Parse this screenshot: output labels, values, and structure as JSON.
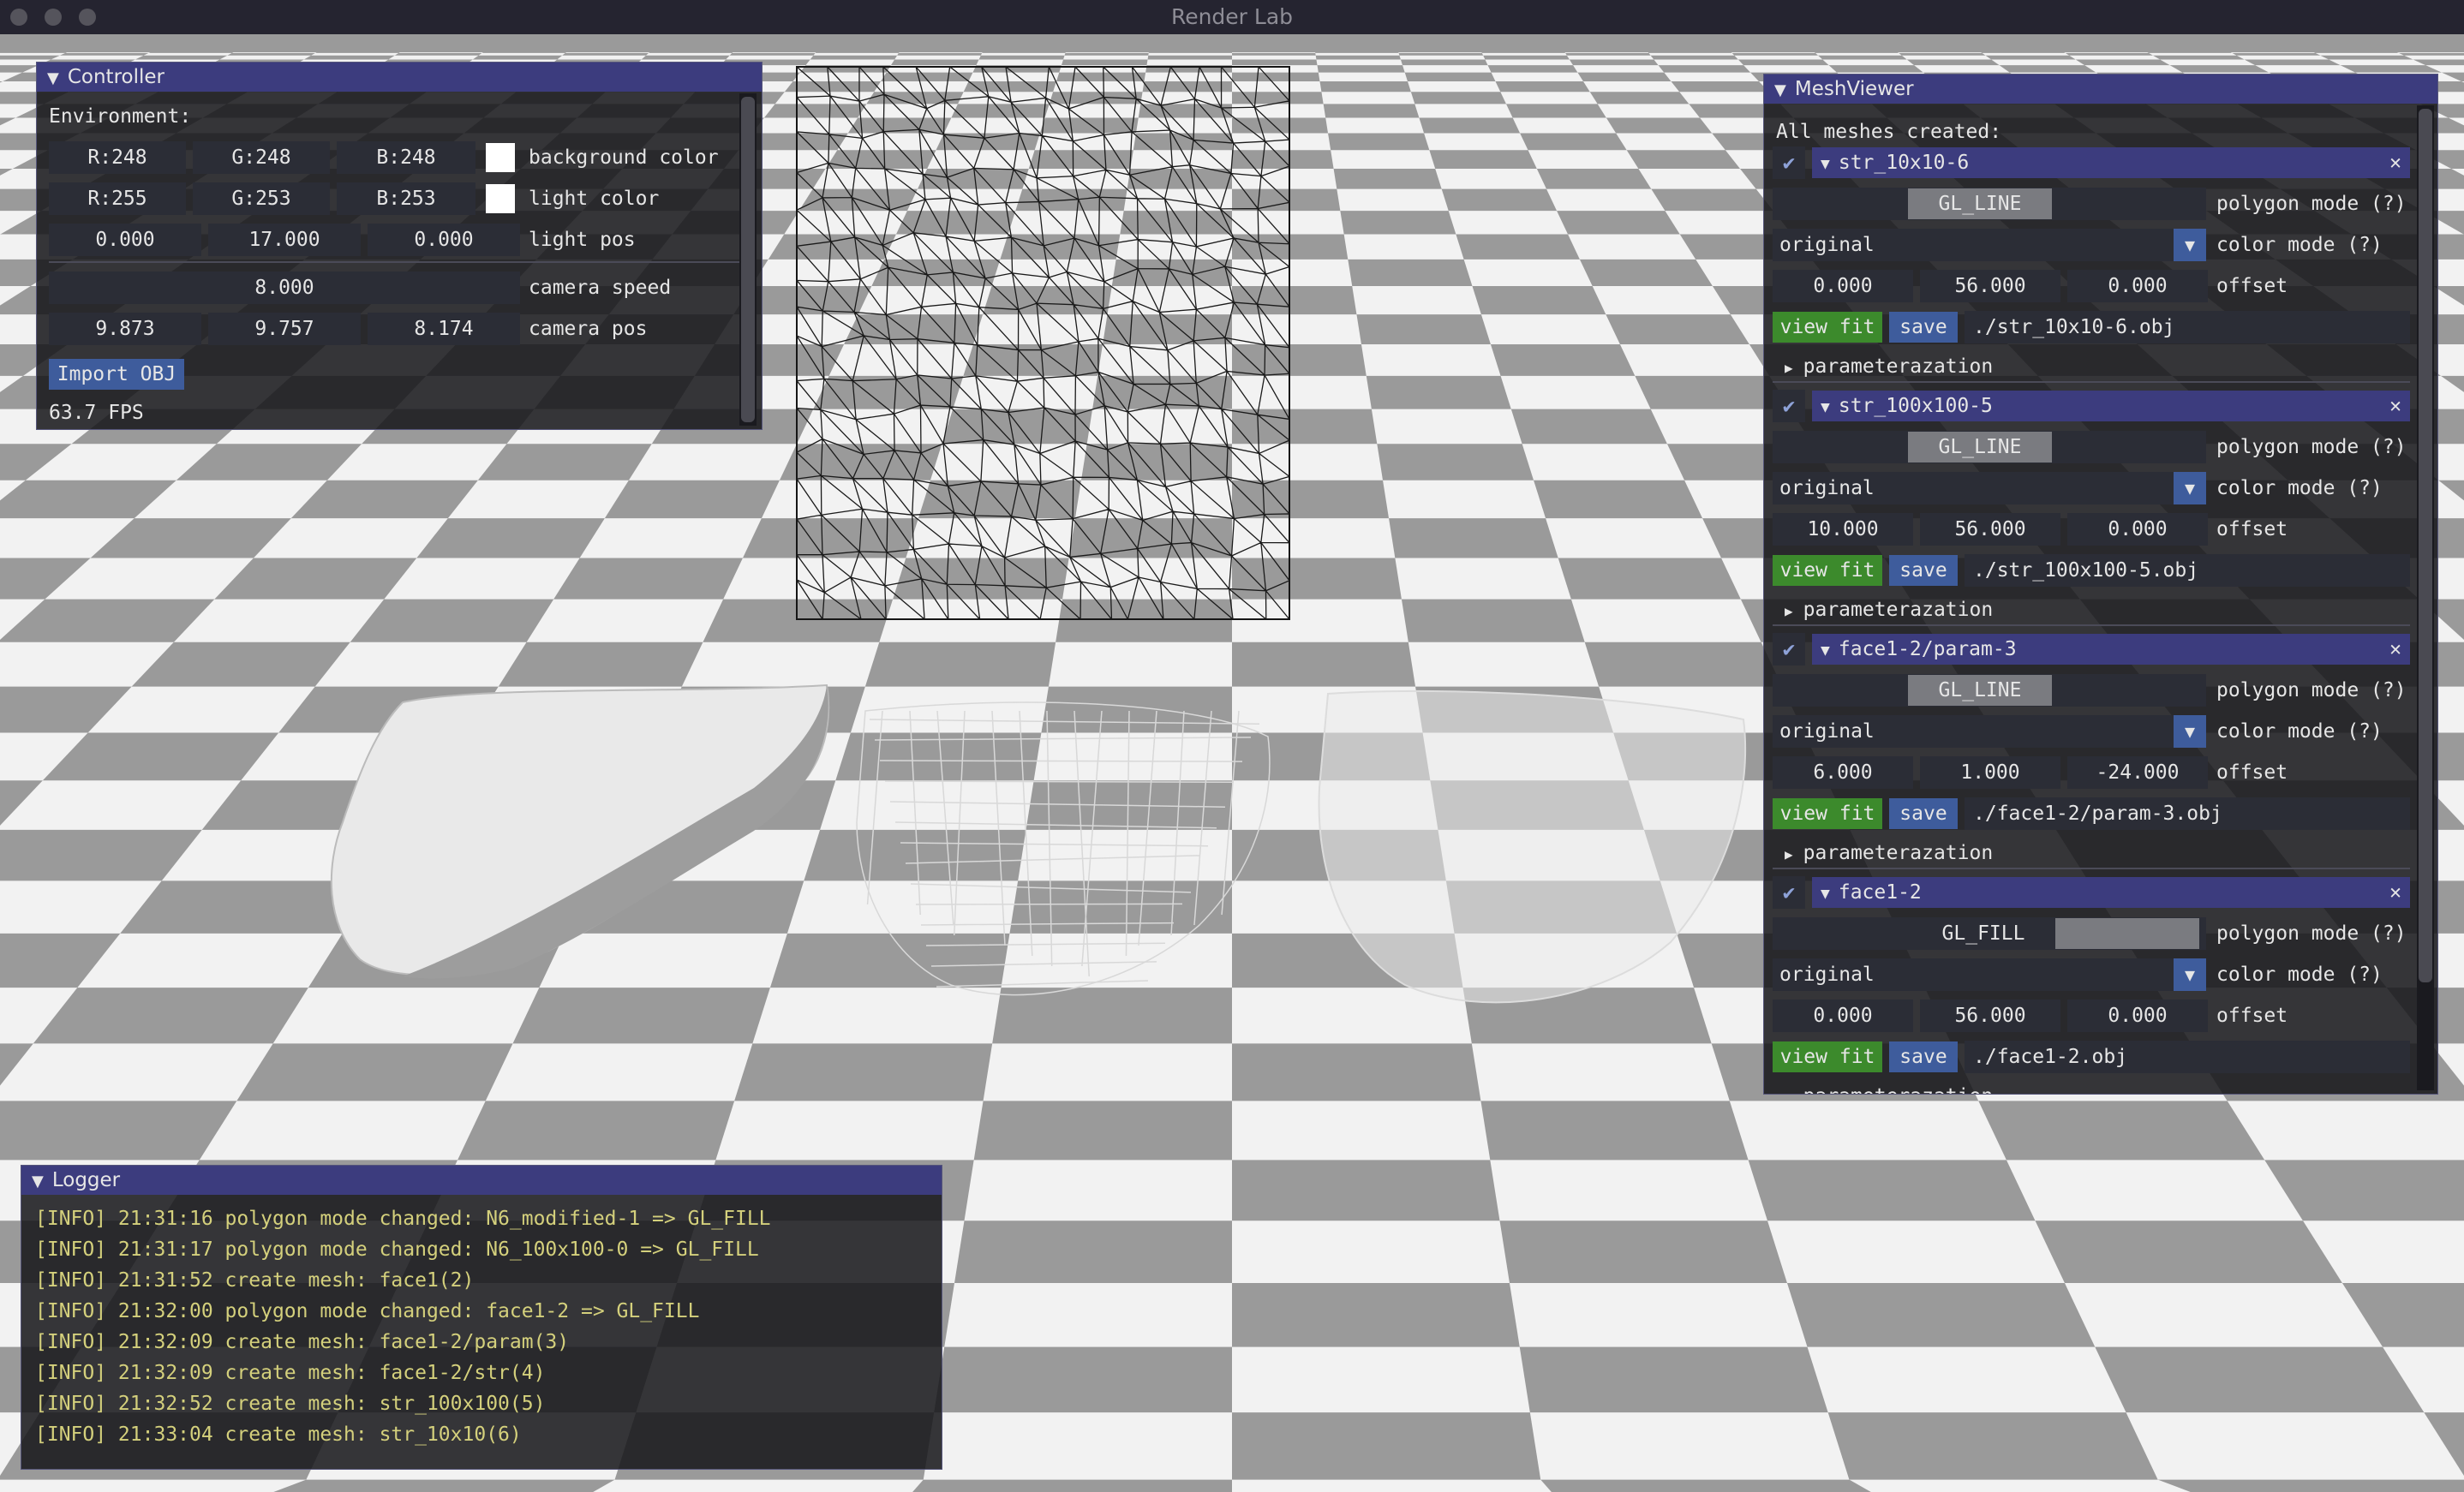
{
  "window": {
    "title": "Render Lab"
  },
  "controller": {
    "title": "Controller",
    "env_label": "Environment:",
    "bg_r": "R:248",
    "bg_g": "G:248",
    "bg_b": "B:248",
    "bg_label": "background color",
    "li_r": "R:255",
    "li_g": "G:253",
    "li_b": "B:253",
    "li_label": "light color",
    "lp_x": "0.000",
    "lp_y": "17.000",
    "lp_z": "0.000",
    "lp_label": "light pos",
    "speed": "8.000",
    "speed_label": "camera speed",
    "cp_x": "9.873",
    "cp_y": "9.757",
    "cp_z": "8.174",
    "cp_label": "camera pos",
    "import_label": "Import OBJ",
    "fps": "63.7 FPS"
  },
  "meshviewer": {
    "title": "MeshViewer",
    "all_label": "All meshes created:",
    "polygon_label": "polygon mode (?)",
    "color_label": "color mode (?)",
    "offset_label": "offset",
    "viewfit_label": "view fit",
    "save_label": "save",
    "param_label": "parameterazation",
    "meshes": [
      {
        "name": "str_10x10-6",
        "mode": "GL_LINE",
        "color": "original",
        "ox": "0.000",
        "oy": "56.000",
        "oz": "0.000",
        "path": "./str_10x10-6.obj"
      },
      {
        "name": "str_100x100-5",
        "mode": "GL_LINE",
        "color": "original",
        "ox": "10.000",
        "oy": "56.000",
        "oz": "0.000",
        "path": "./str_100x100-5.obj"
      },
      {
        "name": "face1-2/param-3",
        "mode": "GL_LINE",
        "color": "original",
        "ox": "6.000",
        "oy": "1.000",
        "oz": "-24.000",
        "path": "./face1-2/param-3.obj"
      },
      {
        "name": "face1-2",
        "mode": "GL_FILL",
        "color": "original",
        "ox": "0.000",
        "oy": "56.000",
        "oz": "0.000",
        "path": "./face1-2.obj"
      }
    ]
  },
  "logger": {
    "title": "Logger",
    "lines": [
      "[INFO] 21:31:16 polygon mode changed: N6_modified-1 => GL_FILL",
      "[INFO] 21:31:17 polygon mode changed: N6_100x100-0 => GL_FILL",
      "[INFO] 21:31:52 create mesh: face1(2)",
      "[INFO] 21:32:00 polygon mode changed: face1-2 => GL_FILL",
      "[INFO] 21:32:09 create mesh: face1-2/param(3)",
      "[INFO] 21:32:09 create mesh: face1-2/str(4)",
      "[INFO] 21:32:52 create mesh: str_100x100(5)",
      "[INFO] 21:33:04 create mesh: str_10x10(6)"
    ]
  },
  "colors": {
    "header": "#3c3c7e",
    "accent_blue": "#3e5c9c",
    "accent_green": "#3c8a2c",
    "log_text": "#d4d07c"
  }
}
